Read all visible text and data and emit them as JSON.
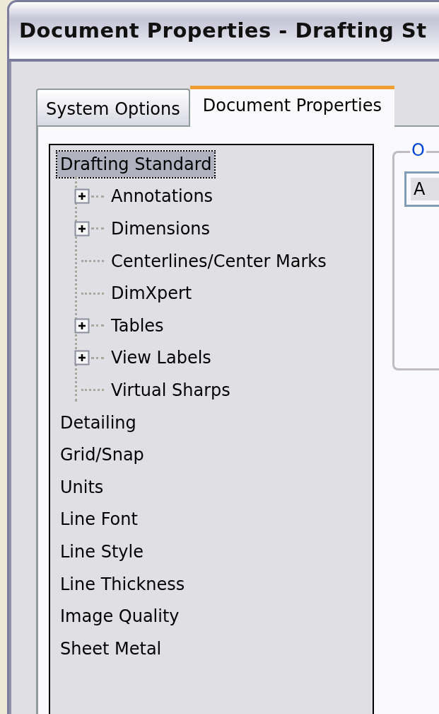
{
  "window": {
    "title": "Document Properties - Drafting St"
  },
  "tabs": [
    {
      "label": "System Options",
      "selected": false
    },
    {
      "label": "Document Properties",
      "selected": true
    }
  ],
  "tree": [
    {
      "label": "Drafting Standard",
      "selected": true,
      "children": [
        {
          "label": "Annotations",
          "kind": "folder",
          "expanded": false
        },
        {
          "label": "Dimensions",
          "kind": "folder",
          "expanded": false
        },
        {
          "label": "Centerlines/Center Marks",
          "kind": "leaf"
        },
        {
          "label": "DimXpert",
          "kind": "leaf"
        },
        {
          "label": "Tables",
          "kind": "folder",
          "expanded": false
        },
        {
          "label": "View Labels",
          "kind": "folder",
          "expanded": false
        },
        {
          "label": "Virtual Sharps",
          "kind": "leaf"
        }
      ]
    },
    {
      "label": "Detailing",
      "selected": false
    },
    {
      "label": "Grid/Snap",
      "selected": false
    },
    {
      "label": "Units",
      "selected": false
    },
    {
      "label": "Line Font",
      "selected": false
    },
    {
      "label": "Line Style",
      "selected": false
    },
    {
      "label": "Line Thickness",
      "selected": false
    },
    {
      "label": "Image Quality",
      "selected": false
    },
    {
      "label": "Sheet Metal",
      "selected": false
    }
  ],
  "group": {
    "legend": "O",
    "field_value": "A"
  }
}
